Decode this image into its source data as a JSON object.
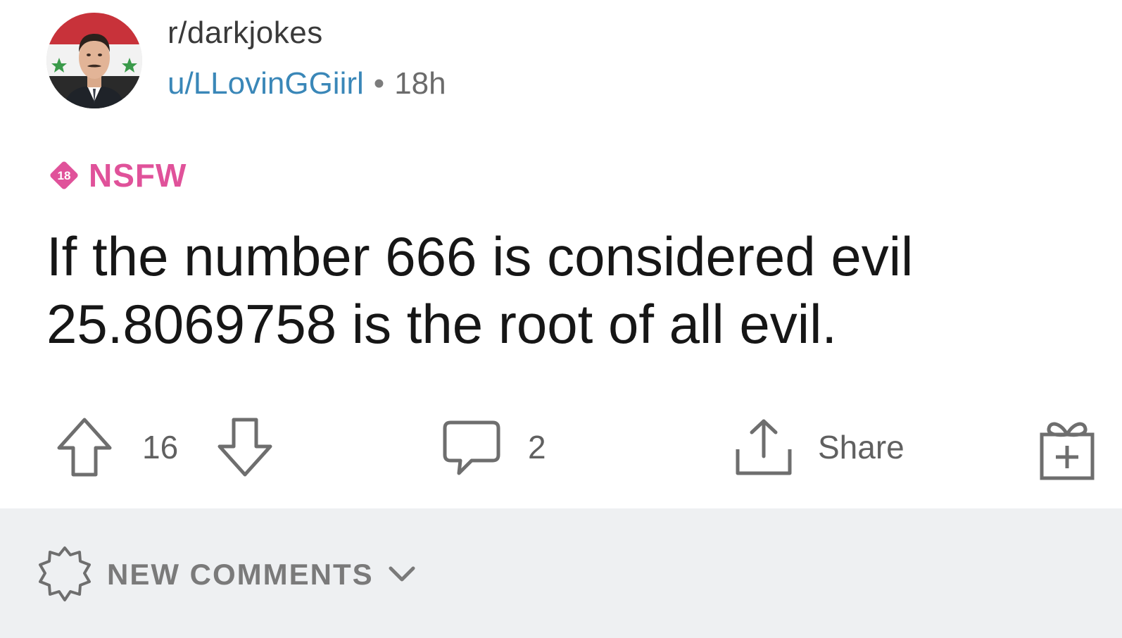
{
  "post": {
    "subreddit": "r/darkjokes",
    "author": "u/LLovinGGiirl",
    "separator": "•",
    "age": "18h",
    "nsfw_badge": "18",
    "nsfw_label": "NSFW",
    "title": "If the number 666 is considered evil 25.8069758 is the root of all evil."
  },
  "actions": {
    "score": "16",
    "comments_count": "2",
    "share_label": "Share"
  },
  "comments_bar": {
    "sort_label": "NEW COMMENTS"
  },
  "colors": {
    "author_link": "#3a87b8",
    "nsfw": "#e0529a",
    "icon_gray": "#6e6e6e",
    "bottom_bg": "#eef0f2"
  },
  "icons": {
    "avatar": "avatar",
    "nsfw": "nsfw-18-icon",
    "upvote": "upvote-arrow-icon",
    "downvote": "downvote-arrow-icon",
    "comment": "comment-bubble-icon",
    "share": "share-upload-icon",
    "award": "gift-award-icon",
    "sort": "sparkle-badge-icon",
    "chevron": "chevron-down-icon"
  }
}
